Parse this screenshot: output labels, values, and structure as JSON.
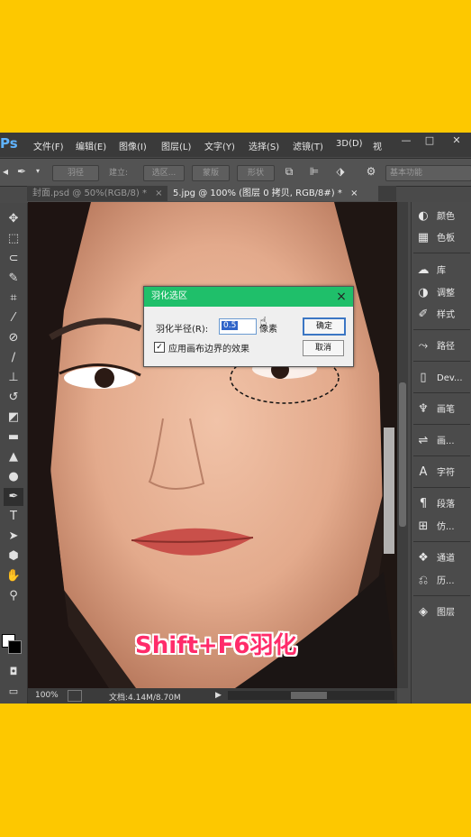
{
  "app": {
    "logo": "Ps"
  },
  "menu": {
    "items": [
      "文件(F)",
      "编辑(E)",
      "图像(I)",
      "图层(L)",
      "文字(Y)",
      "选择(S)",
      "滤镜(T)",
      "3D(D)",
      "视"
    ]
  },
  "window_controls": {
    "minimize": "—",
    "maximize": "□",
    "close": "✕"
  },
  "options_bar": {
    "feather": "羽径",
    "make_label": "建立:",
    "selection_btn": "选区...",
    "mask_btn": "蒙版",
    "shape_btn": "形状",
    "workspace": "基本功能"
  },
  "tabs": [
    {
      "label": "封面.psd @ 50%(RGB/8) *",
      "close": "×",
      "active": false
    },
    {
      "label": "5.jpg @ 100% (图层 0 拷贝, RGB/8#) *",
      "close": "×",
      "active": true
    }
  ],
  "tools": [
    "move-icon",
    "marquee-icon",
    "lasso-icon",
    "quick-select-icon",
    "crop-icon",
    "eyedropper-icon",
    "healing-icon",
    "brush-icon",
    "stamp-icon",
    "history-brush-icon",
    "eraser-icon",
    "gradient-icon",
    "blur-icon",
    "dodge-icon",
    "pen-icon",
    "type-icon",
    "path-select-icon",
    "shape-icon",
    "hand-icon",
    "zoom-icon"
  ],
  "panels": {
    "items": [
      {
        "icon": "color-icon",
        "label": "颜色"
      },
      {
        "icon": "swatches-icon",
        "label": "色板"
      },
      {
        "icon": "library-icon",
        "label": "库"
      },
      {
        "icon": "adjustments-icon",
        "label": "调整"
      },
      {
        "icon": "styles-icon",
        "label": "样式"
      },
      {
        "icon": "paths-icon",
        "label": "路径"
      },
      {
        "icon": "device-icon",
        "label": "Dev..."
      },
      {
        "icon": "brush-presets-icon",
        "label": "画笔"
      },
      {
        "icon": "brush-settings-icon",
        "label": "画..."
      },
      {
        "icon": "character-icon",
        "label": "字符"
      },
      {
        "icon": "paragraph-icon",
        "label": "段落"
      },
      {
        "icon": "clone-source-icon",
        "label": "仿..."
      },
      {
        "icon": "channels-icon",
        "label": "通道"
      },
      {
        "icon": "history-icon",
        "label": "历..."
      },
      {
        "icon": "layers-icon",
        "label": "图层"
      }
    ]
  },
  "status": {
    "zoom": "100%",
    "doc": "文档:4.14M/8.70M",
    "arrow": "▶"
  },
  "dialog": {
    "title": "羽化选区",
    "close": "×",
    "radius_label": "羽化半径(R):",
    "radius_value": "0.5",
    "unit": "像素",
    "checkbox_label": "应用画布边界的效果",
    "checkbox_checked": "✓",
    "ok": "确定",
    "cancel": "取消"
  },
  "caption": "Shift+F6羽化",
  "colors": {
    "accent": "#1fbf6a",
    "background": "#fdc800",
    "caption": "#ff2c6a"
  }
}
